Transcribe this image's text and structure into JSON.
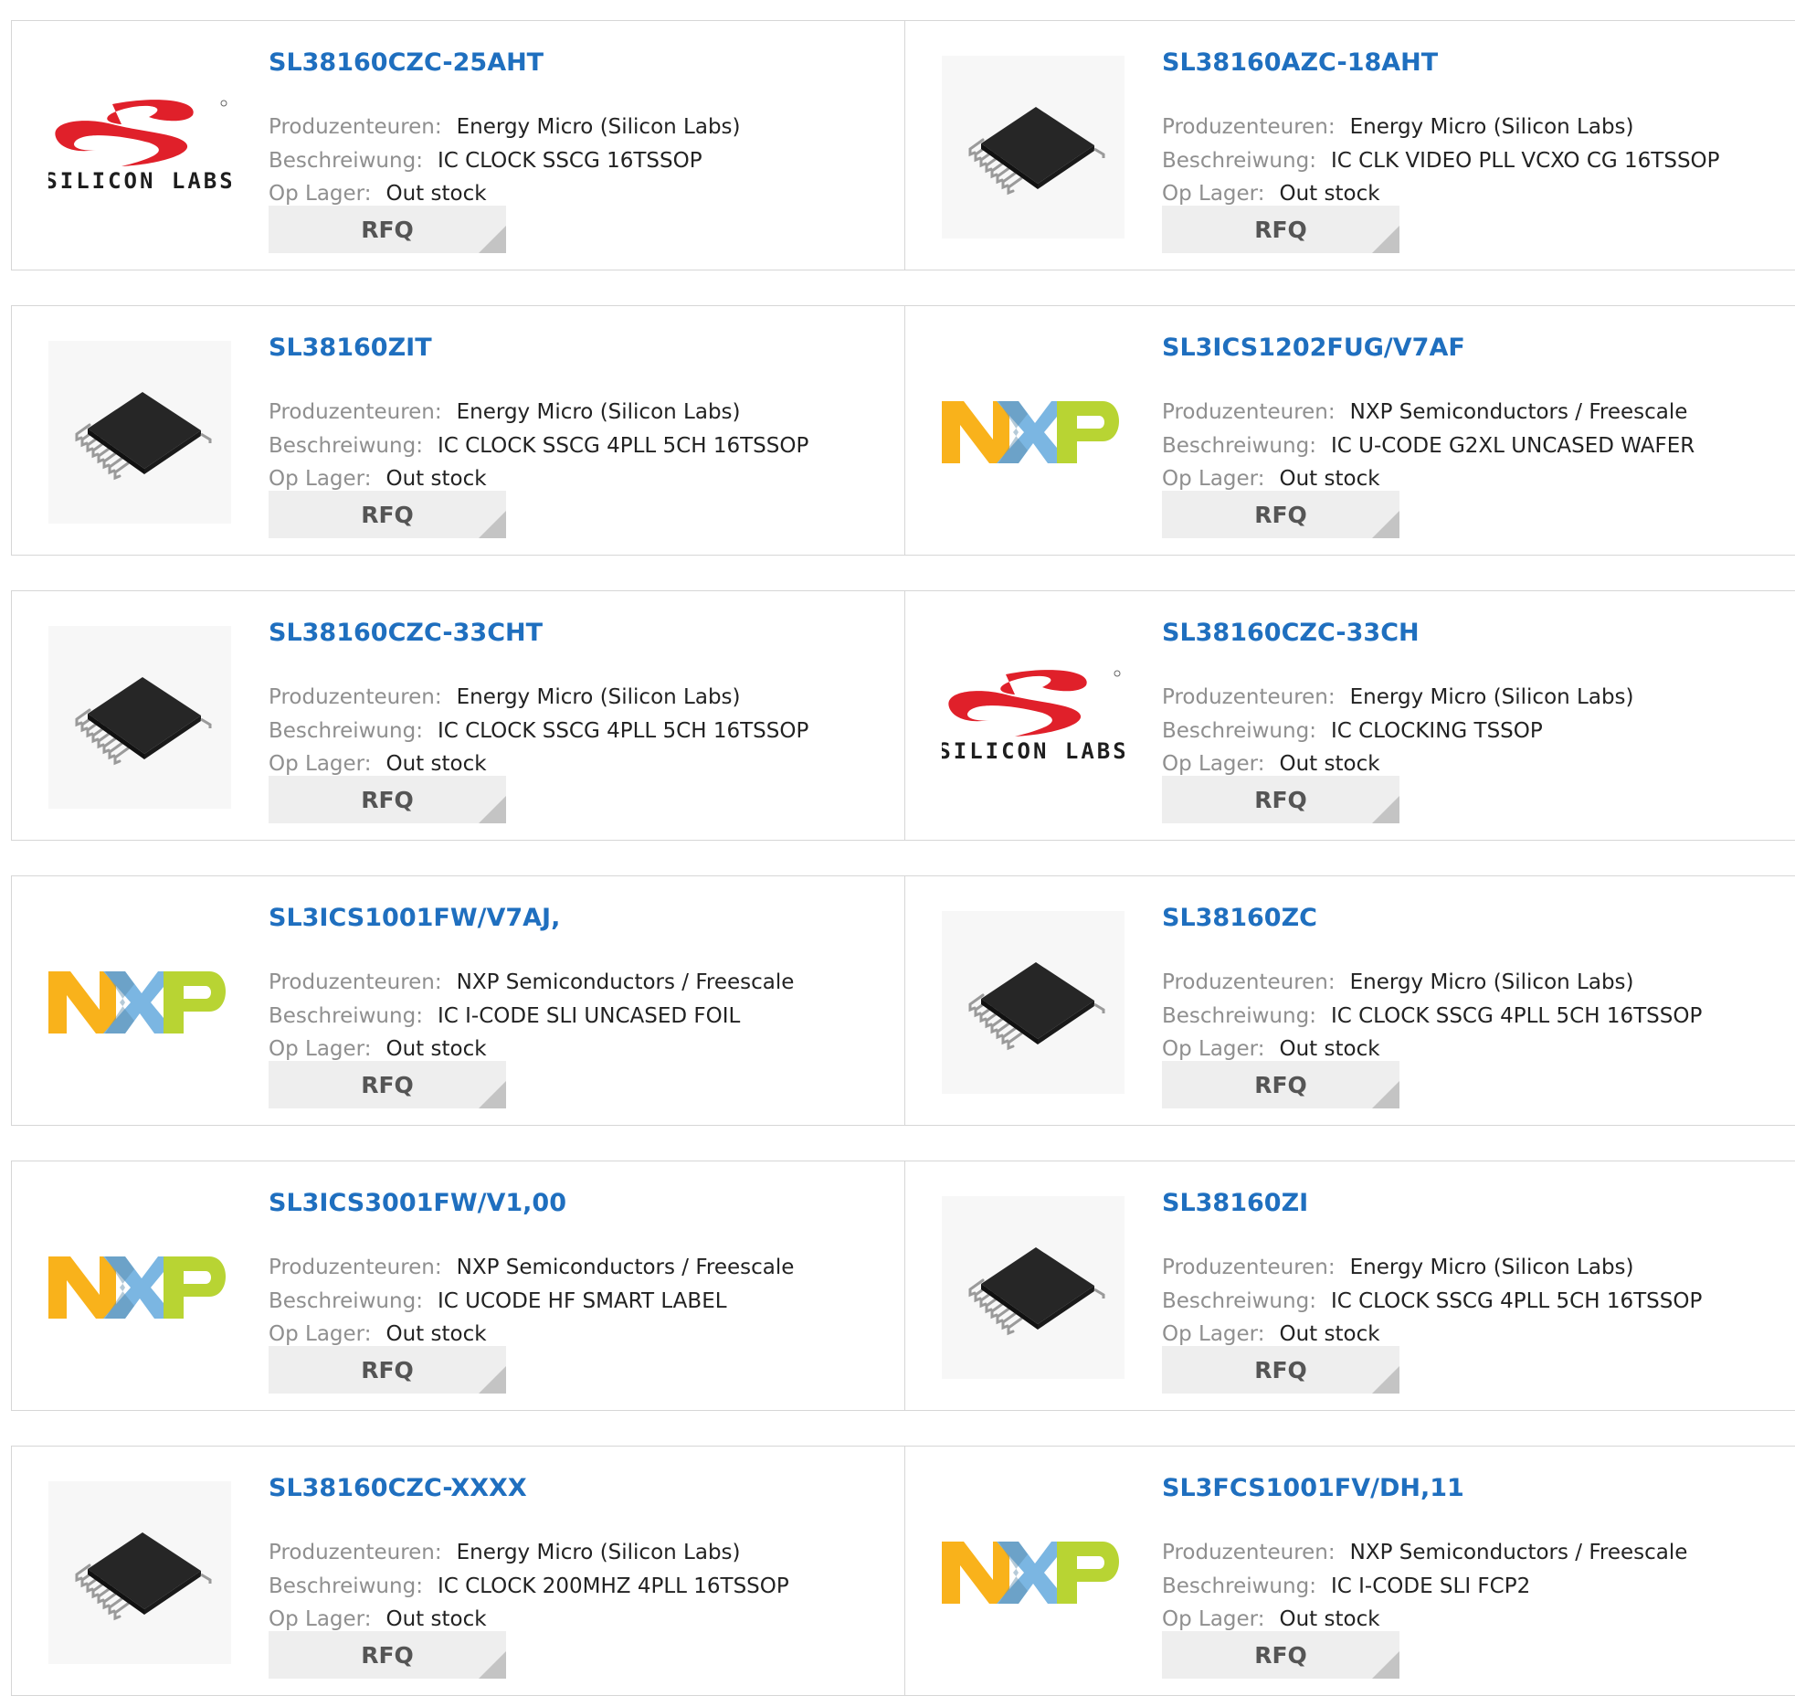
{
  "labels": {
    "manufacturer": "Produzenteuren:",
    "description": "Beschreiwung:",
    "stock": "Op Lager:",
    "rfq": "RFQ"
  },
  "logos": {
    "silicon_labs_text": "SILICON LABS",
    "nxp_text": "NXP"
  },
  "colors": {
    "part_link": "#1f6fbf",
    "label": "#8f8f8f",
    "value": "#222222",
    "rfq_bg": "#eeeeee",
    "silicon_labs_red": "#e0202a",
    "nxp_orange": "#f9b21b",
    "nxp_blue": "#7bb6e2",
    "nxp_green": "#b8d433"
  },
  "products": [
    {
      "part": "SL38160CZC-25AHT",
      "manufacturer": "Energy Micro (Silicon Labs)",
      "description": "IC CLOCK SSCG 16TSSOP",
      "stock": "Out stock",
      "image": "silicon-labs-logo"
    },
    {
      "part": "SL38160AZC-18AHT",
      "manufacturer": "Energy Micro (Silicon Labs)",
      "description": "IC CLK VIDEO PLL VCXO CG 16TSSOP",
      "stock": "Out stock",
      "image": "tssop-chip"
    },
    {
      "part": "SL38160ZIT",
      "manufacturer": "Energy Micro (Silicon Labs)",
      "description": "IC CLOCK SSCG 4PLL 5CH 16TSSOP",
      "stock": "Out stock",
      "image": "tssop-chip"
    },
    {
      "part": "SL3ICS1202FUG/V7AF",
      "manufacturer": "NXP Semiconductors / Freescale",
      "description": "IC U-CODE G2XL UNCASED WAFER",
      "stock": "Out stock",
      "image": "nxp-logo"
    },
    {
      "part": "SL38160CZC-33CHT",
      "manufacturer": "Energy Micro (Silicon Labs)",
      "description": "IC CLOCK SSCG 4PLL 5CH 16TSSOP",
      "stock": "Out stock",
      "image": "tssop-chip"
    },
    {
      "part": "SL38160CZC-33CH",
      "manufacturer": "Energy Micro (Silicon Labs)",
      "description": "IC CLOCKING TSSOP",
      "stock": "Out stock",
      "image": "silicon-labs-logo"
    },
    {
      "part": "SL3ICS1001FW/V7AJ,",
      "manufacturer": "NXP Semiconductors / Freescale",
      "description": "IC I-CODE SLI UNCASED FOIL",
      "stock": "Out stock",
      "image": "nxp-logo"
    },
    {
      "part": "SL38160ZC",
      "manufacturer": "Energy Micro (Silicon Labs)",
      "description": "IC CLOCK SSCG 4PLL 5CH 16TSSOP",
      "stock": "Out stock",
      "image": "tssop-chip"
    },
    {
      "part": "SL3ICS3001FW/V1,00",
      "manufacturer": "NXP Semiconductors / Freescale",
      "description": "IC UCODE HF SMART LABEL",
      "stock": "Out stock",
      "image": "nxp-logo"
    },
    {
      "part": "SL38160ZI",
      "manufacturer": "Energy Micro (Silicon Labs)",
      "description": "IC CLOCK SSCG 4PLL 5CH 16TSSOP",
      "stock": "Out stock",
      "image": "tssop-chip"
    },
    {
      "part": "SL38160CZC-XXXX",
      "manufacturer": "Energy Micro (Silicon Labs)",
      "description": "IC CLOCK 200MHZ 4PLL 16TSSOP",
      "stock": "Out stock",
      "image": "tssop-chip"
    },
    {
      "part": "SL3FCS1001FV/DH,11",
      "manufacturer": "NXP Semiconductors / Freescale",
      "description": "IC I-CODE SLI FCP2",
      "stock": "Out stock",
      "image": "nxp-logo"
    }
  ]
}
